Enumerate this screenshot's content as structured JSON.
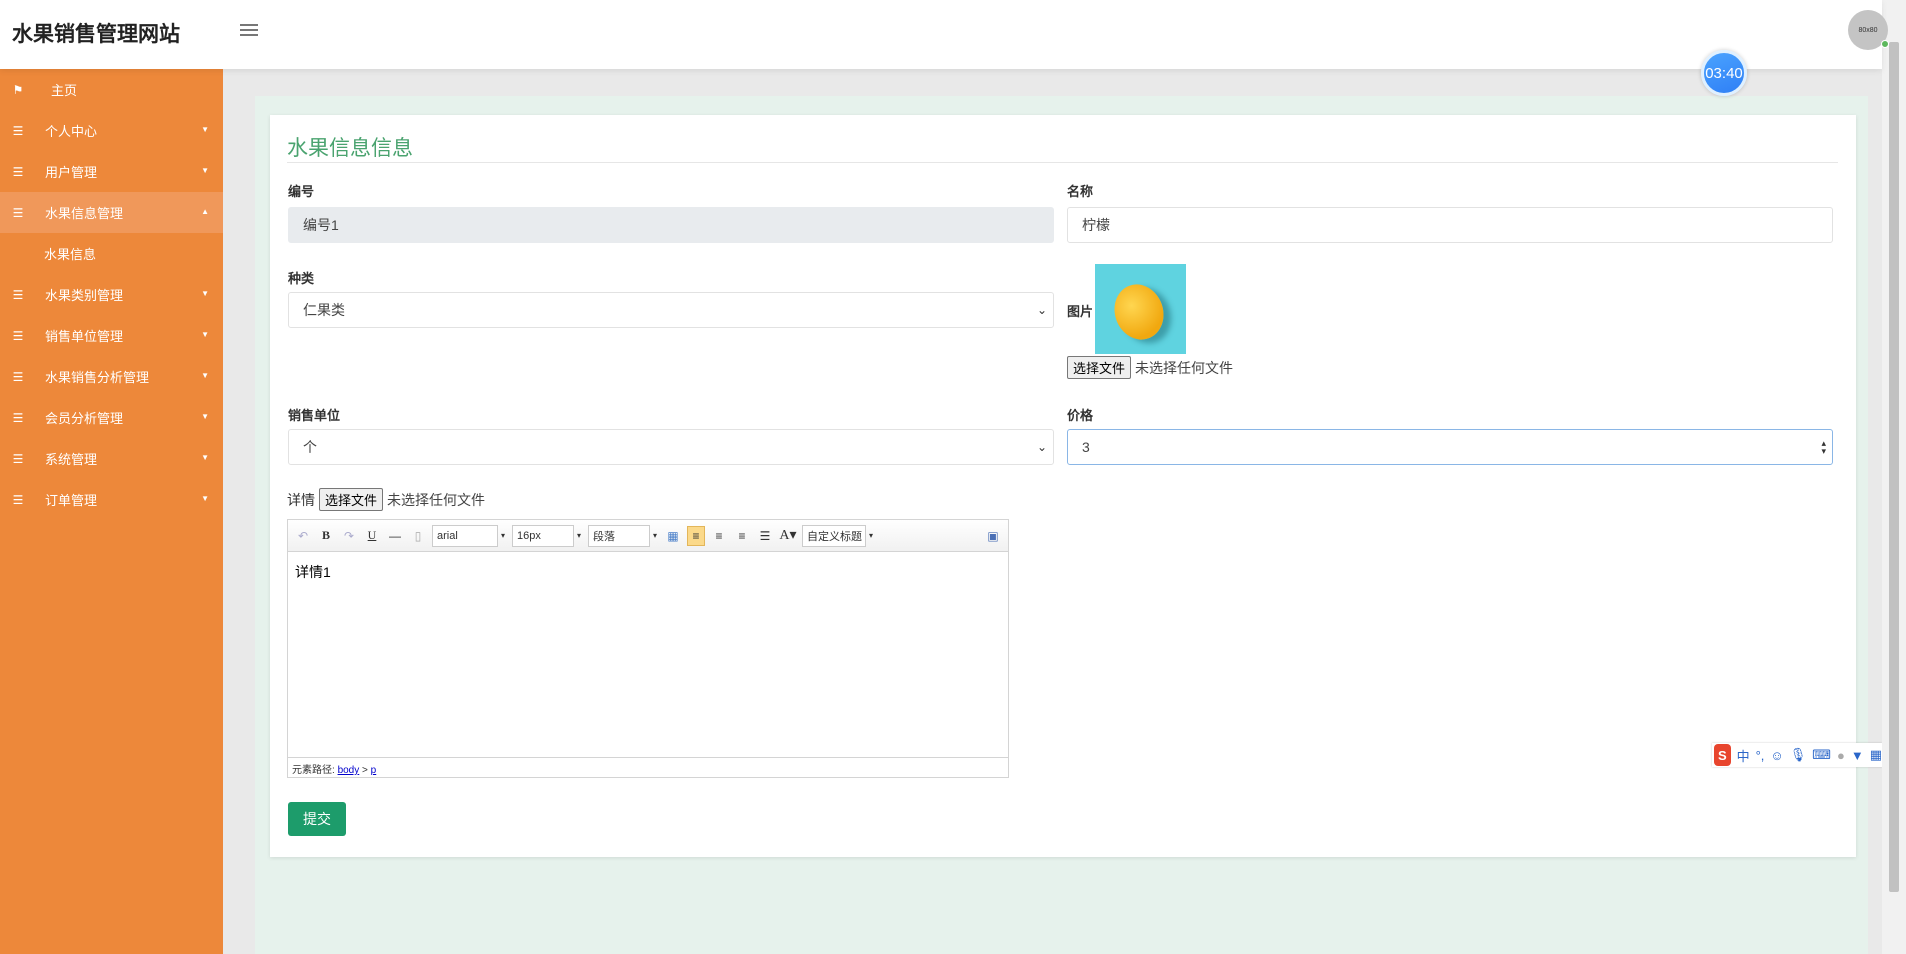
{
  "header": {
    "brand": "水果销售管理网站",
    "avatar_text": "80x80",
    "timer": "03:40"
  },
  "sidebar": {
    "items": [
      {
        "label": "主页",
        "icon": "flag-icon"
      },
      {
        "label": "个人中心",
        "icon": "list-icon"
      },
      {
        "label": "用户管理",
        "icon": "list-icon"
      },
      {
        "label": "水果信息管理",
        "icon": "list-icon",
        "active": true
      },
      {
        "label": "水果信息",
        "sub": true
      },
      {
        "label": "水果类别管理",
        "icon": "list-icon"
      },
      {
        "label": "销售单位管理",
        "icon": "list-icon"
      },
      {
        "label": "水果销售分析管理",
        "icon": "list-icon"
      },
      {
        "label": "会员分析管理",
        "icon": "list-icon"
      },
      {
        "label": "系统管理",
        "icon": "list-icon"
      },
      {
        "label": "订单管理",
        "icon": "list-icon"
      }
    ]
  },
  "form": {
    "title": "水果信息信息",
    "number_label": "编号",
    "number_value": "编号1",
    "name_label": "名称",
    "name_value": "柠檬",
    "category_label": "种类",
    "category_value": "仁果类",
    "image_label": "图片",
    "file_button": "选择文件",
    "no_file": "未选择任何文件",
    "unit_label": "销售单位",
    "unit_value": "个",
    "price_label": "价格",
    "price_value": "3",
    "detail_label": "详情",
    "editor": {
      "font": "arial",
      "size": "16px",
      "paragraph": "段落",
      "custom_title": "自定义标题",
      "content": "详情1",
      "path_label": "元素路径:",
      "path_body": "body",
      "path_sep": ">",
      "path_p": "p"
    },
    "submit": "提交"
  },
  "ime": {
    "lang": "中",
    "punct": "°,"
  }
}
